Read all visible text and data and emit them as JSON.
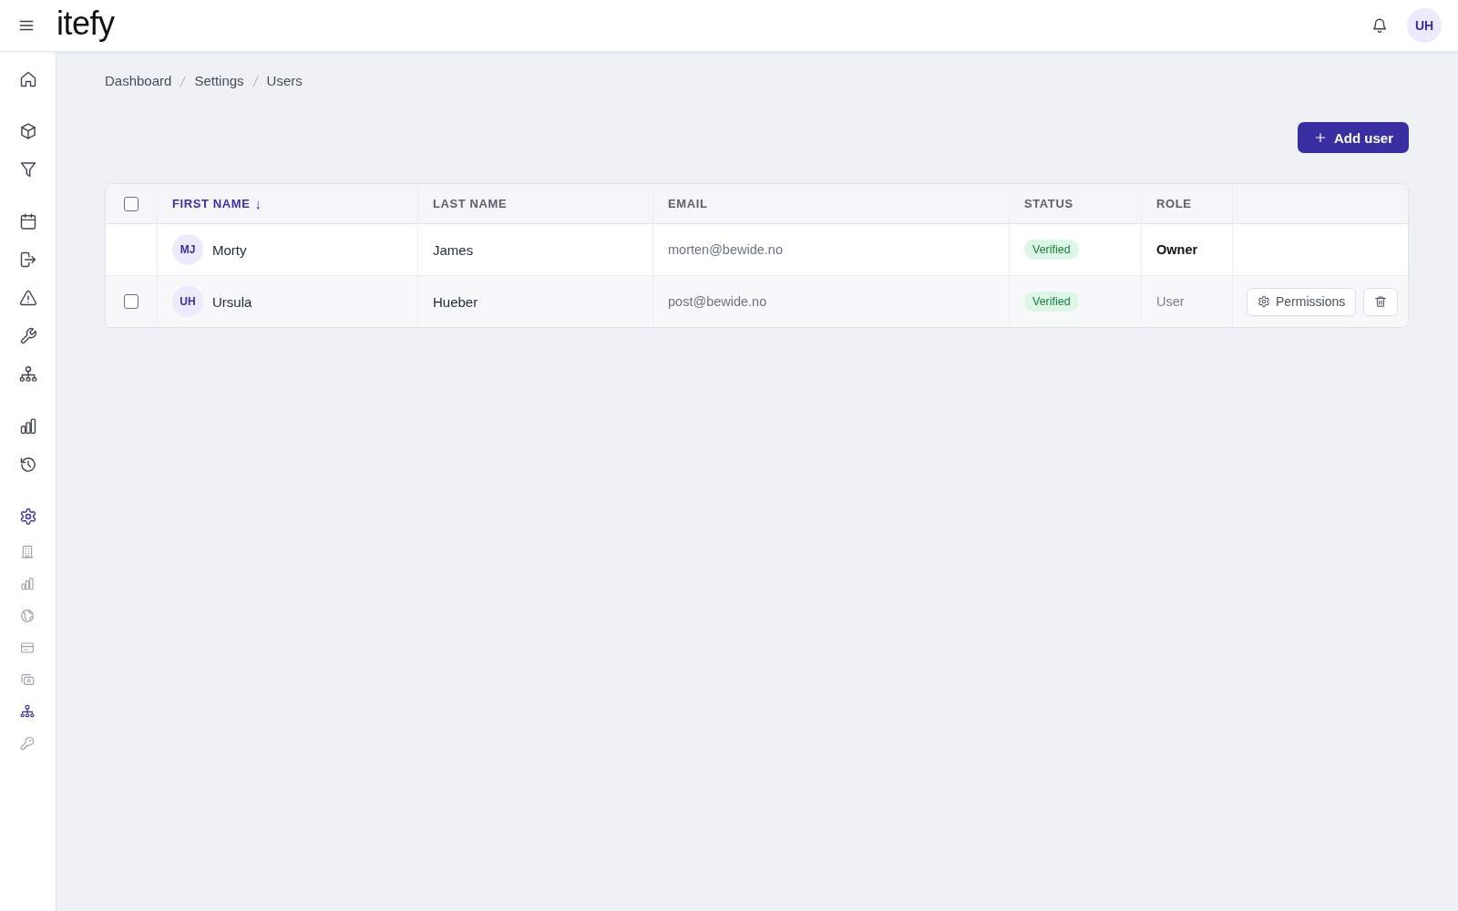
{
  "topbar": {
    "logo": "itefy",
    "avatar": "UH"
  },
  "sidebar": {
    "groups": [
      {
        "items": [
          {
            "kind": "home",
            "selected": false
          }
        ]
      },
      {
        "items": [
          {
            "kind": "cube",
            "selected": false
          },
          {
            "kind": "funnel",
            "selected": false
          }
        ]
      },
      {
        "items": [
          {
            "kind": "calendar",
            "selected": false
          },
          {
            "kind": "exit",
            "selected": false
          },
          {
            "kind": "warning",
            "selected": false
          },
          {
            "kind": "wrench",
            "selected": false
          },
          {
            "kind": "team",
            "selected": false
          }
        ]
      },
      {
        "items": [
          {
            "kind": "bar-chart",
            "selected": false
          },
          {
            "kind": "history",
            "selected": false
          }
        ]
      },
      {
        "items": [
          {
            "kind": "settings",
            "selected": true,
            "children": [
              {
                "kind": "building",
                "selected": false
              },
              {
                "kind": "bar-chart",
                "selected": false
              },
              {
                "kind": "globe",
                "selected": false
              },
              {
                "kind": "card",
                "selected": false
              },
              {
                "kind": "cash",
                "selected": false
              },
              {
                "kind": "team",
                "selected": true
              },
              {
                "kind": "key",
                "selected": false
              }
            ]
          }
        ]
      }
    ]
  },
  "breadcrumb": [
    "Dashboard",
    "Settings",
    "Users"
  ],
  "add_button": {
    "label": "Add user"
  },
  "table": {
    "select_all": {
      "checked": false
    },
    "columns": [
      {
        "label": "FIRST NAME",
        "sorted": true,
        "sort_arrow": "↓"
      },
      {
        "label": "LAST NAME",
        "sorted": false
      },
      {
        "label": "EMAIL",
        "sorted": false
      },
      {
        "label": "STATUS",
        "sorted": false
      },
      {
        "label": "ROLE",
        "sorted": false
      }
    ],
    "rows": [
      {
        "kind": "owner",
        "initials": "MJ",
        "first_name": "Morty",
        "last_name": "James",
        "email": "morten@bewide.no",
        "status": "Verified",
        "role": "Owner"
      },
      {
        "kind": "member",
        "checked": false,
        "initials": "UH",
        "first_name": "Ursula",
        "last_name": "Hueber",
        "email": "post@bewide.no",
        "status": "Verified",
        "role": "User",
        "actions": [
          {
            "kind": "permissions",
            "label": "Permissions"
          },
          {
            "kind": "delete"
          }
        ]
      }
    ]
  }
}
